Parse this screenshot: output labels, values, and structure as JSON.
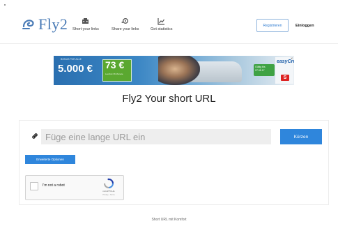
{
  "header": {
    "logo_text": "Fly2",
    "nav": [
      {
        "label": "Short your links",
        "icon": "building-icon"
      },
      {
        "label": "Share your links",
        "icon": "share-icon"
      },
      {
        "label": "Get statistics",
        "icon": "chart-icon"
      }
    ],
    "register_label": "Registrieren",
    "login_label": "Einloggen"
  },
  "ad": {
    "amount": "5.000 €",
    "top_small": "BONUS FÜR ALLE",
    "green_amount": "73 €",
    "green_sub": "Laufzeit 36 Monate",
    "badge_text": "Gültig bis 27.05.17",
    "brand": "easyCredit",
    "close": "✕"
  },
  "main": {
    "title": "Fly2 Your short URL",
    "url_placeholder": "Füge eine lange URL ein",
    "shorten_label": "Kürzen",
    "options_label": "Erweiterte Optionen"
  },
  "captcha": {
    "label": "I'm not a robot",
    "brand": "reCAPTCHA",
    "terms": "Privacy - Terms"
  },
  "footer": {
    "text": "Short URL mit Komfort"
  },
  "colors": {
    "accent": "#2f86dc",
    "logo": "#4a7bb6"
  }
}
